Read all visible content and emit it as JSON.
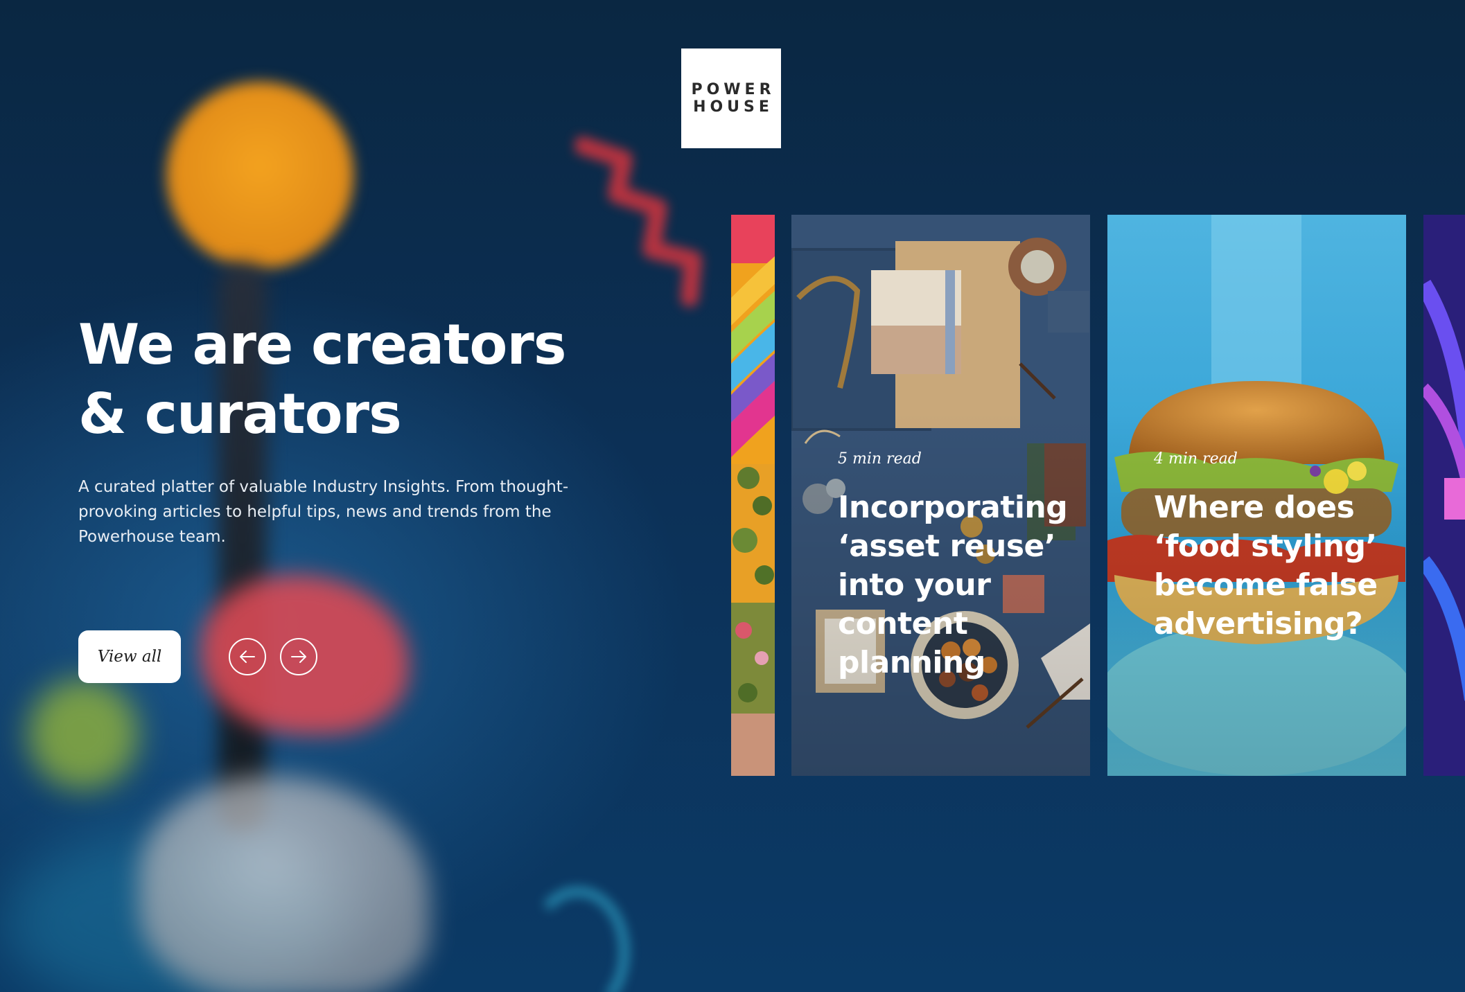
{
  "brand": {
    "logo_line1": "POWER",
    "logo_line2": "HOUSE"
  },
  "hero": {
    "title_line1": "We are creators",
    "title_line2": "& curators",
    "description": "A curated platter of valuable Industry Insights. From thought-provoking articles to helpful tips, news and trends from the Powerhouse team."
  },
  "controls": {
    "view_all_label": "View all",
    "prev_icon": "arrow-left-icon",
    "next_icon": "arrow-right-icon"
  },
  "articles": [
    {
      "read_time": "5 min read",
      "title": "Incorporating ‘asset reuse’ into your content planning",
      "image": "flat-lay-design-materials"
    },
    {
      "read_time": "4 min read",
      "title": "Where does ‘food styling’ become false advertising?",
      "image": "burger-on-blue-plate"
    }
  ],
  "colors": {
    "background": "#0b2c4d",
    "text": "#ffffff",
    "button_bg": "#ffffff"
  }
}
